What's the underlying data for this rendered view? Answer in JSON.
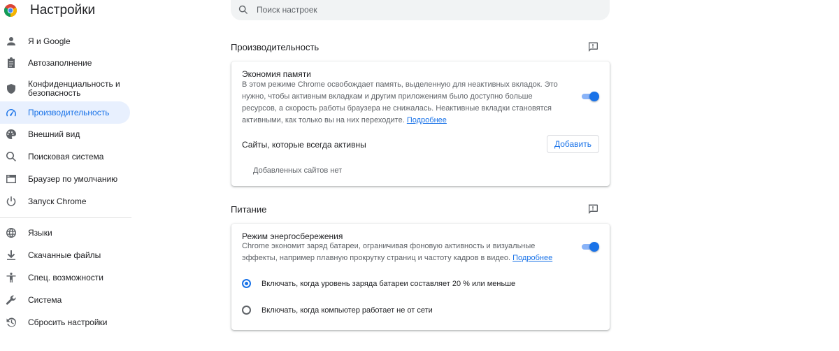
{
  "app": {
    "title": "Настройки"
  },
  "search": {
    "placeholder": "Поиск настроек"
  },
  "sidebar": {
    "items": [
      {
        "label": "Я и Google",
        "icon": "person-icon"
      },
      {
        "label": "Автозаполнение",
        "icon": "clipboard-icon"
      },
      {
        "label": "Конфиденциальность и безопасность",
        "icon": "shield-icon"
      },
      {
        "label": "Производительность",
        "icon": "speedometer-icon",
        "active": true
      },
      {
        "label": "Внешний вид",
        "icon": "palette-icon"
      },
      {
        "label": "Поисковая система",
        "icon": "search-icon"
      },
      {
        "label": "Браузер по умолчанию",
        "icon": "browser-window-icon"
      },
      {
        "label": "Запуск Chrome",
        "icon": "power-icon"
      },
      {
        "label": "Языки",
        "icon": "globe-icon"
      },
      {
        "label": "Скачанные файлы",
        "icon": "download-icon"
      },
      {
        "label": "Спец. возможности",
        "icon": "accessibility-icon"
      },
      {
        "label": "Система",
        "icon": "wrench-icon"
      },
      {
        "label": "Сбросить настройки",
        "icon": "restore-icon"
      }
    ]
  },
  "performance": {
    "title": "Производительность",
    "memory_saver": {
      "title": "Экономия памяти",
      "description": "В этом режиме Chrome освобождает память, выделенную для неактивных вкладок. Это нужно, чтобы активным вкладкам и другим приложениям было доступно больше ресурсов, а скорость работы браузера не снижалась. Неактивные вкладки становятся активными, как только вы на них переходите.",
      "link": "Подробнее",
      "enabled": true
    },
    "always_active": {
      "label": "Сайты, которые всегда активны",
      "add_button": "Добавить",
      "empty_text": "Добавленных сайтов нет"
    }
  },
  "power": {
    "title": "Питание",
    "energy_saver": {
      "title": "Режим энергосбережения",
      "description": "Chrome экономит заряд батареи, ограничивая фоновую активность и визуальные эффекты, например плавную прокрутку страниц и частоту кадров в видео.",
      "link": "Подробнее",
      "enabled": true
    },
    "options": [
      {
        "label": "Включать, когда уровень заряда батареи составляет 20 % или меньше",
        "checked": true
      },
      {
        "label": "Включать, когда компьютер работает не от сети",
        "checked": false
      }
    ]
  },
  "colors": {
    "accent": "#1a73e8",
    "active_bg": "#e8f0fe",
    "toggle_track": "#8ab4f8"
  }
}
